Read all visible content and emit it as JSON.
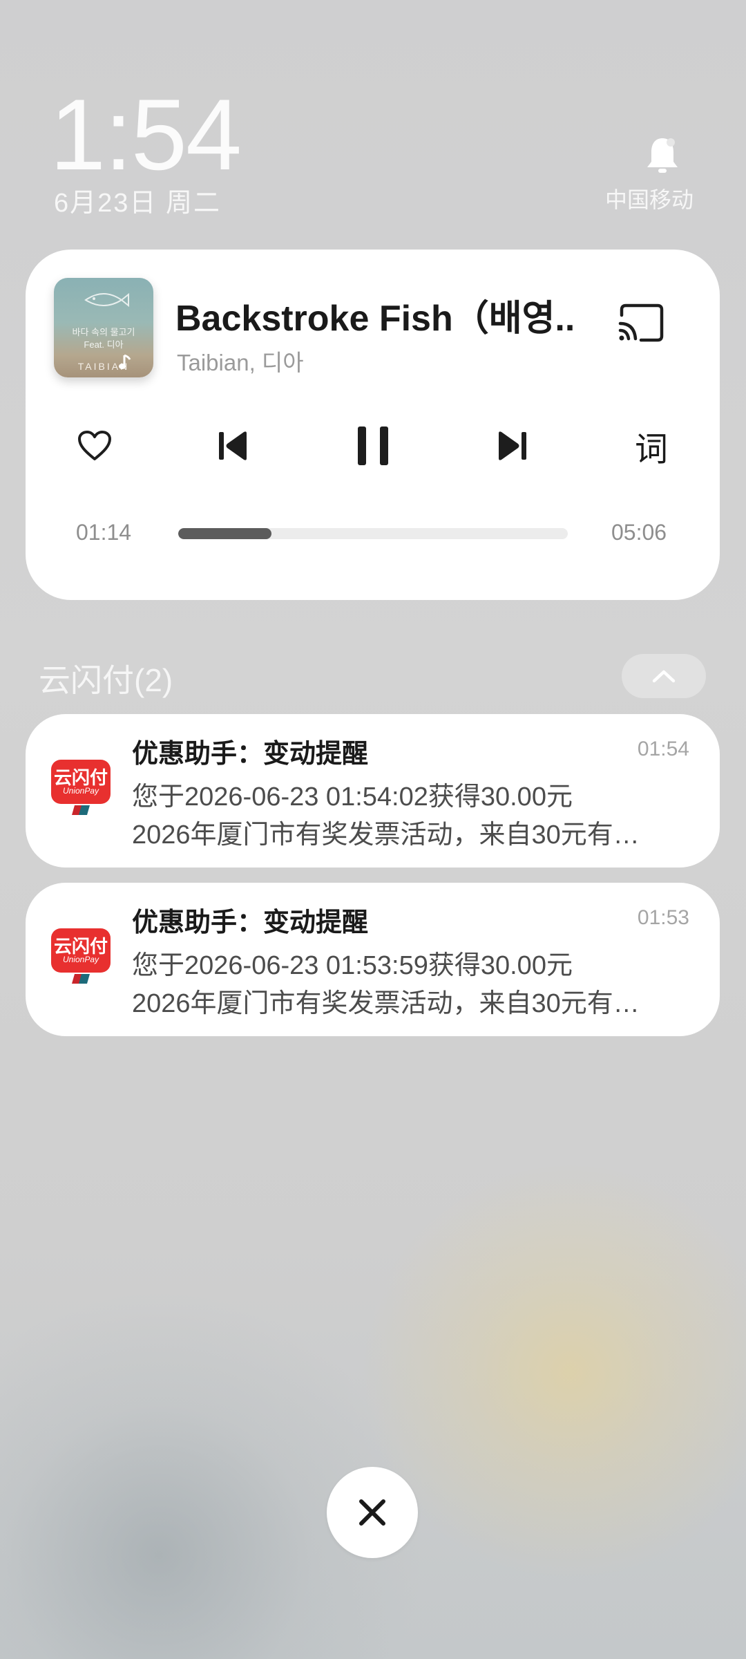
{
  "status": {
    "time": "1:54",
    "date": "6月23日 周二",
    "carrier": "中国移动"
  },
  "music": {
    "title": "Backstroke Fish（배영...",
    "artist": "Taibian, 디아",
    "album_art_text": [
      "바다 속의 물고기",
      "Feat. 디아",
      "TAIBIAN"
    ],
    "elapsed": "01:14",
    "duration": "05:06",
    "progress": 0.24,
    "lyrics_label": "词"
  },
  "group": {
    "title": "云闪付(2)"
  },
  "notifications": [
    {
      "app_logo_text": "云闪付",
      "app_logo_sub": "UnionPay",
      "title": "优惠助手：变动提醒",
      "time": "01:54",
      "line1": "您于2026-06-23 01:54:02获得30.00元",
      "line2": "2026年厦门市有奖发票活动，来自30元有…"
    },
    {
      "app_logo_text": "云闪付",
      "app_logo_sub": "UnionPay",
      "title": "优惠助手：变动提醒",
      "time": "01:53",
      "line1": "您于2026-06-23 01:53:59获得30.00元",
      "line2": "2026年厦门市有奖发票活动，来自30元有…"
    }
  ],
  "colors": {
    "unionpay_red": "#e8302f",
    "progress_fill": "#5c5c5c"
  }
}
